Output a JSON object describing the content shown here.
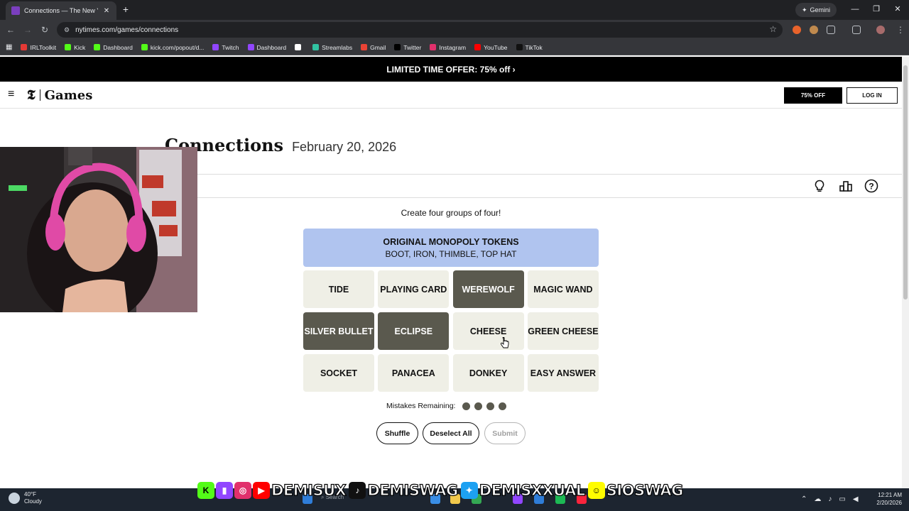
{
  "browser": {
    "tab_title": "Connections — The New York T",
    "tab_close": "✕",
    "new_tab": "+",
    "gemini_label": "Gemini",
    "url": "nytimes.com/games/connections",
    "bookmarks": [
      {
        "label": "IRLToolkit",
        "color": "#e53935"
      },
      {
        "label": "Kick",
        "color": "#53fc18"
      },
      {
        "label": "Dashboard",
        "color": "#53fc18"
      },
      {
        "label": "kick.com/popout/d...",
        "color": "#53fc18"
      },
      {
        "label": "Twitch",
        "color": "#9146ff"
      },
      {
        "label": "Dashboard",
        "color": "#9146ff"
      },
      {
        "label": "",
        "color": "#ffffff"
      },
      {
        "label": "Streamlabs",
        "color": "#31c3a2"
      },
      {
        "label": "Gmail",
        "color": "#ea4335"
      },
      {
        "label": "Twitter",
        "color": "#000000"
      },
      {
        "label": "Instagram",
        "color": "#e1306c"
      },
      {
        "label": "YouTube",
        "color": "#ff0000"
      },
      {
        "label": "TikTok",
        "color": "#111111"
      }
    ]
  },
  "page": {
    "promo_text": "LIMITED TIME OFFER: 75% off ›",
    "logo_text": "Games",
    "offer_button": "75% OFF",
    "login_button": "LOG IN",
    "game_title": "Connections",
    "game_date": "February 20, 2026",
    "instructions": "Create four groups of four!",
    "solved_group": {
      "title": "ORIGINAL MONOPOLY TOKENS",
      "members": "BOOT, IRON, THIMBLE, TOP HAT",
      "color": "#b0c4ef"
    },
    "cards": [
      {
        "label": "TIDE",
        "selected": false
      },
      {
        "label": "PLAYING CARD",
        "selected": false
      },
      {
        "label": "WEREWOLF",
        "selected": true
      },
      {
        "label": "MAGIC WAND",
        "selected": false
      },
      {
        "label": "SILVER BULLET",
        "selected": true
      },
      {
        "label": "ECLIPSE",
        "selected": true
      },
      {
        "label": "CHEESE",
        "selected": false
      },
      {
        "label": "GREEN CHEESE",
        "selected": false
      },
      {
        "label": "SOCKET",
        "selected": false
      },
      {
        "label": "PANACEA",
        "selected": false
      },
      {
        "label": "DONKEY",
        "selected": false
      },
      {
        "label": "EASY ANSWER",
        "selected": false
      }
    ],
    "mistakes_label": "Mistakes Remaining:",
    "mistakes_remaining": 4,
    "buttons": {
      "shuffle": "Shuffle",
      "deselect": "Deselect All",
      "submit": "Submit"
    }
  },
  "overlay": {
    "socials": [
      "DEMISUX",
      "DEMISWAG",
      "DEMISXXUAL",
      "SIOSWAG"
    ]
  },
  "taskbar": {
    "temperature": "40°F",
    "condition": "Cloudy",
    "search_label": "Search",
    "time": "12:21 AM",
    "date": "2/20/2026"
  }
}
